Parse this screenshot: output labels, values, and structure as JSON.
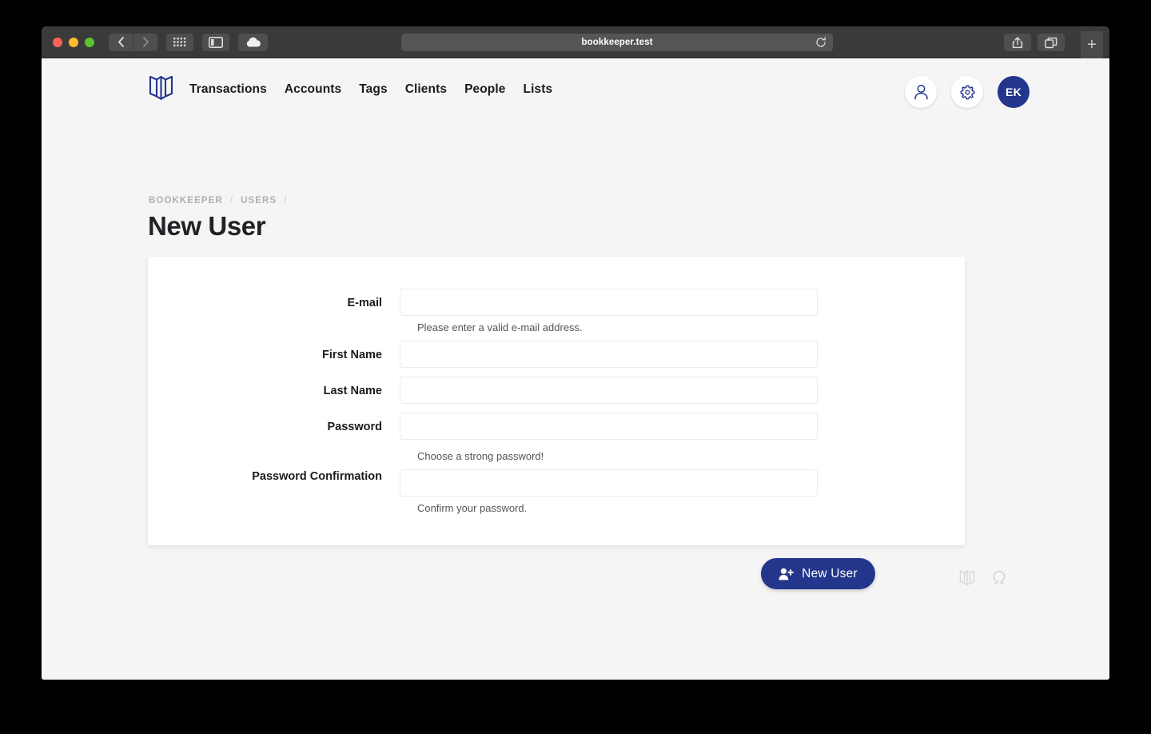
{
  "browser": {
    "url": "bookkeeper.test",
    "controls": {
      "close": "close-window",
      "minimize": "minimize-window",
      "maximize": "maximize-window",
      "back": "‹",
      "forward": "›",
      "tab_overview": "grid-icon",
      "sidebar": "sidebar-icon",
      "icloud": "cloud-icon",
      "reload": "reload-icon",
      "share": "share-icon",
      "tabs": "tabs-icon",
      "new_tab": "+"
    }
  },
  "app": {
    "brand": "bookkeeper-logo",
    "menu": [
      {
        "label": "Transactions"
      },
      {
        "label": "Accounts"
      },
      {
        "label": "Tags"
      },
      {
        "label": "Clients"
      },
      {
        "label": "People"
      },
      {
        "label": "Lists"
      }
    ],
    "actions": {
      "profile_icon": "user-icon",
      "settings_icon": "gear-icon",
      "avatar_initials": "EK"
    },
    "colors": {
      "brand_navy": "#24368c",
      "page_bg": "#f5f5f6",
      "card_bg": "#ffffff",
      "text": "#1b1b1f",
      "muted": "#b0b0b4"
    }
  },
  "breadcrumb": {
    "items": [
      "BOOKKEEPER",
      "USERS"
    ],
    "separator": "/"
  },
  "page": {
    "title": "New User"
  },
  "form": {
    "fields": [
      {
        "label": "E-mail",
        "value": "",
        "help": "Please enter a valid e-mail address."
      },
      {
        "label": "First Name",
        "value": "",
        "help": ""
      },
      {
        "label": "Last Name",
        "value": "",
        "help": ""
      },
      {
        "label": "Password",
        "value": "",
        "help": "Choose a strong password!"
      },
      {
        "label": "Password Confirmation",
        "value": "",
        "help": "Confirm your password."
      }
    ],
    "submit": {
      "label": "New User",
      "icon": "person-plus-icon"
    }
  },
  "footer": {
    "icons": [
      "book-icon",
      "omega-icon"
    ]
  }
}
